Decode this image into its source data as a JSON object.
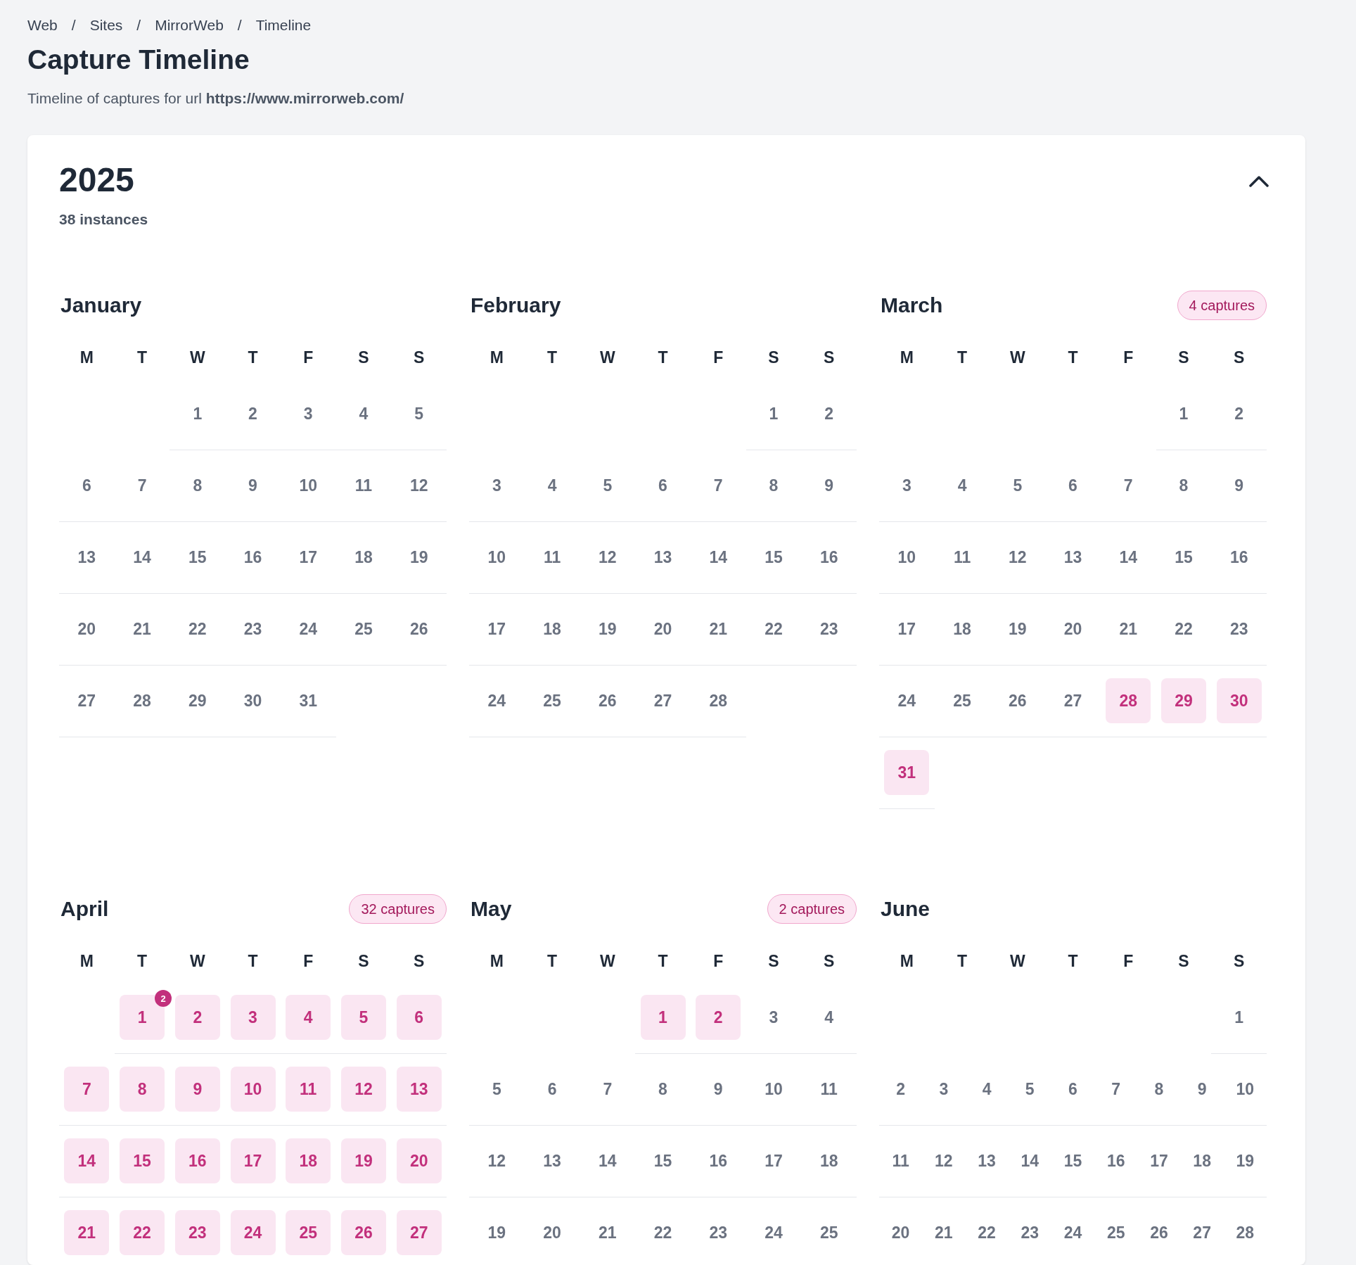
{
  "breadcrumb": {
    "items": [
      "Web",
      "Sites",
      "MirrorWeb",
      "Timeline"
    ],
    "separators": [
      "/",
      "/",
      "/"
    ]
  },
  "title": "Capture Timeline",
  "subtitle": "Timeline of captures for url **https://www.mirrorweb.com/**",
  "year": {
    "label": "2025",
    "instances": "38 instances",
    "expanded": true
  },
  "months": [
    {
      "name": "January",
      "weekdays": [
        "M",
        "T",
        "W",
        "T",
        "F",
        "S",
        "S"
      ],
      "weeks": [
        {
          "kind": "first",
          "days": [
            {
              "day": "1",
              "captured": false
            },
            {
              "day": "2",
              "captured": false
            },
            {
              "day": "3",
              "captured": false
            },
            {
              "day": "4",
              "captured": false
            },
            {
              "day": "5",
              "captured": false
            }
          ]
        },
        {
          "kind": "week",
          "days": [
            {
              "day": "6",
              "captured": false
            },
            {
              "day": "7",
              "captured": false
            },
            {
              "day": "8",
              "captured": false
            },
            {
              "day": "9",
              "captured": false
            },
            {
              "day": "10",
              "captured": false
            },
            {
              "day": "11",
              "captured": false
            },
            {
              "day": "12",
              "captured": false
            }
          ]
        },
        {
          "kind": "week",
          "days": [
            {
              "day": "13",
              "captured": false
            },
            {
              "day": "14",
              "captured": false
            },
            {
              "day": "15",
              "captured": false
            },
            {
              "day": "16",
              "captured": false
            },
            {
              "day": "17",
              "captured": false
            },
            {
              "day": "18",
              "captured": false
            },
            {
              "day": "19",
              "captured": false
            }
          ]
        },
        {
          "kind": "week",
          "days": [
            {
              "day": "20",
              "captured": false
            },
            {
              "day": "21",
              "captured": false
            },
            {
              "day": "22",
              "captured": false
            },
            {
              "day": "23",
              "captured": false
            },
            {
              "day": "24",
              "captured": false
            },
            {
              "day": "25",
              "captured": false
            },
            {
              "day": "26",
              "captured": false
            }
          ]
        },
        {
          "kind": "week",
          "days": [
            {
              "day": "27",
              "captured": false
            },
            {
              "day": "28",
              "captured": false
            },
            {
              "day": "29",
              "captured": false
            },
            {
              "day": "30",
              "captured": false
            },
            {
              "day": "31",
              "captured": false
            }
          ]
        }
      ]
    },
    {
      "name": "February",
      "weekdays": [
        "M",
        "T",
        "W",
        "T",
        "F",
        "S",
        "S"
      ],
      "weeks": [
        {
          "kind": "first",
          "days": [
            {
              "day": "1",
              "captured": false
            },
            {
              "day": "2",
              "captured": false
            }
          ]
        },
        {
          "kind": "week",
          "days": [
            {
              "day": "3",
              "captured": false
            },
            {
              "day": "4",
              "captured": false
            },
            {
              "day": "5",
              "captured": false
            },
            {
              "day": "6",
              "captured": false
            },
            {
              "day": "7",
              "captured": false
            },
            {
              "day": "8",
              "captured": false
            },
            {
              "day": "9",
              "captured": false
            }
          ]
        },
        {
          "kind": "week",
          "days": [
            {
              "day": "10",
              "captured": false
            },
            {
              "day": "11",
              "captured": false
            },
            {
              "day": "12",
              "captured": false
            },
            {
              "day": "13",
              "captured": false
            },
            {
              "day": "14",
              "captured": false
            },
            {
              "day": "15",
              "captured": false
            },
            {
              "day": "16",
              "captured": false
            }
          ]
        },
        {
          "kind": "week",
          "days": [
            {
              "day": "17",
              "captured": false
            },
            {
              "day": "18",
              "captured": false
            },
            {
              "day": "19",
              "captured": false
            },
            {
              "day": "20",
              "captured": false
            },
            {
              "day": "21",
              "captured": false
            },
            {
              "day": "22",
              "captured": false
            },
            {
              "day": "23",
              "captured": false
            }
          ]
        },
        {
          "kind": "week",
          "days": [
            {
              "day": "24",
              "captured": false
            },
            {
              "day": "25",
              "captured": false
            },
            {
              "day": "26",
              "captured": false
            },
            {
              "day": "27",
              "captured": false
            },
            {
              "day": "28",
              "captured": false
            }
          ]
        }
      ]
    },
    {
      "name": "March",
      "captures": "4 captures",
      "weekdays": [
        "M",
        "T",
        "W",
        "T",
        "F",
        "S",
        "S"
      ],
      "weeks": [
        {
          "kind": "first",
          "days": [
            {
              "day": "1",
              "captured": false
            },
            {
              "day": "2",
              "captured": false
            }
          ]
        },
        {
          "kind": "week",
          "days": [
            {
              "day": "3",
              "captured": false
            },
            {
              "day": "4",
              "captured": false
            },
            {
              "day": "5",
              "captured": false
            },
            {
              "day": "6",
              "captured": false
            },
            {
              "day": "7",
              "captured": false
            },
            {
              "day": "8",
              "captured": false
            },
            {
              "day": "9",
              "captured": false
            }
          ]
        },
        {
          "kind": "week",
          "days": [
            {
              "day": "10",
              "captured": false
            },
            {
              "day": "11",
              "captured": false
            },
            {
              "day": "12",
              "captured": false
            },
            {
              "day": "13",
              "captured": false
            },
            {
              "day": "14",
              "captured": false
            },
            {
              "day": "15",
              "captured": false
            },
            {
              "day": "16",
              "captured": false
            }
          ]
        },
        {
          "kind": "week",
          "days": [
            {
              "day": "17",
              "captured": false
            },
            {
              "day": "18",
              "captured": false
            },
            {
              "day": "19",
              "captured": false
            },
            {
              "day": "20",
              "captured": false
            },
            {
              "day": "21",
              "captured": false
            },
            {
              "day": "22",
              "captured": false
            },
            {
              "day": "23",
              "captured": false
            }
          ]
        },
        {
          "kind": "week",
          "days": [
            {
              "day": "24",
              "captured": false
            },
            {
              "day": "25",
              "captured": false
            },
            {
              "day": "26",
              "captured": false
            },
            {
              "day": "27",
              "captured": false
            },
            {
              "day": "28",
              "captured": true
            },
            {
              "day": "29",
              "captured": true
            },
            {
              "day": "30",
              "captured": true
            }
          ]
        },
        {
          "kind": "week",
          "days": [
            {
              "day": "31",
              "captured": true
            }
          ]
        }
      ]
    },
    {
      "name": "April",
      "captures": "32 captures",
      "weekdays": [
        "M",
        "T",
        "W",
        "T",
        "F",
        "S",
        "S"
      ],
      "weeks": [
        {
          "kind": "first",
          "days": [
            {
              "day": "1",
              "captured": true,
              "count": "2"
            },
            {
              "day": "2",
              "captured": true
            },
            {
              "day": "3",
              "captured": true
            },
            {
              "day": "4",
              "captured": true
            },
            {
              "day": "5",
              "captured": true
            },
            {
              "day": "6",
              "captured": true
            }
          ]
        },
        {
          "kind": "week",
          "days": [
            {
              "day": "7",
              "captured": true
            },
            {
              "day": "8",
              "captured": true
            },
            {
              "day": "9",
              "captured": true
            },
            {
              "day": "10",
              "captured": true
            },
            {
              "day": "11",
              "captured": true
            },
            {
              "day": "12",
              "captured": true
            },
            {
              "day": "13",
              "captured": true
            }
          ]
        },
        {
          "kind": "week",
          "days": [
            {
              "day": "14",
              "captured": true
            },
            {
              "day": "15",
              "captured": true
            },
            {
              "day": "16",
              "captured": true
            },
            {
              "day": "17",
              "captured": true
            },
            {
              "day": "18",
              "captured": true
            },
            {
              "day": "19",
              "captured": true
            },
            {
              "day": "20",
              "captured": true
            }
          ]
        },
        {
          "kind": "week",
          "days": [
            {
              "day": "21",
              "captured": true
            },
            {
              "day": "22",
              "captured": true
            },
            {
              "day": "23",
              "captured": true
            },
            {
              "day": "24",
              "captured": true
            },
            {
              "day": "25",
              "captured": true
            },
            {
              "day": "26",
              "captured": true
            },
            {
              "day": "27",
              "captured": true
            }
          ]
        }
      ]
    },
    {
      "name": "May",
      "captures": "2 captures",
      "weekdays": [
        "M",
        "T",
        "W",
        "T",
        "F",
        "S",
        "S"
      ],
      "weeks": [
        {
          "kind": "first",
          "days": [
            {
              "day": "1",
              "captured": true
            },
            {
              "day": "2",
              "captured": true
            },
            {
              "day": "3",
              "captured": false
            },
            {
              "day": "4",
              "captured": false
            }
          ]
        },
        {
          "kind": "week",
          "days": [
            {
              "day": "5",
              "captured": false
            },
            {
              "day": "6",
              "captured": false
            },
            {
              "day": "7",
              "captured": false
            },
            {
              "day": "8",
              "captured": false
            },
            {
              "day": "9",
              "captured": false
            },
            {
              "day": "10",
              "captured": false
            },
            {
              "day": "11",
              "captured": false
            }
          ]
        },
        {
          "kind": "week",
          "days": [
            {
              "day": "12",
              "captured": false
            },
            {
              "day": "13",
              "captured": false
            },
            {
              "day": "14",
              "captured": false
            },
            {
              "day": "15",
              "captured": false
            },
            {
              "day": "16",
              "captured": false
            },
            {
              "day": "17",
              "captured": false
            },
            {
              "day": "18",
              "captured": false
            }
          ]
        },
        {
          "kind": "week",
          "days": [
            {
              "day": "19",
              "captured": false
            },
            {
              "day": "20",
              "captured": false
            },
            {
              "day": "21",
              "captured": false
            },
            {
              "day": "22",
              "captured": false
            },
            {
              "day": "23",
              "captured": false
            },
            {
              "day": "24",
              "captured": false
            },
            {
              "day": "25",
              "captured": false
            }
          ]
        }
      ]
    },
    {
      "name": "June",
      "weekdays": [
        "M",
        "T",
        "W",
        "T",
        "F",
        "S",
        "S"
      ],
      "weeks": [
        {
          "kind": "first",
          "days": [
            {
              "day": "1",
              "captured": false
            }
          ]
        },
        {
          "kind": "week",
          "days": [
            {
              "day": "2",
              "captured": false
            },
            {
              "day": "3",
              "captured": false
            },
            {
              "day": "4",
              "captured": false
            },
            {
              "day": "5",
              "captured": false
            },
            {
              "day": "6",
              "captured": false
            },
            {
              "day": "7",
              "captured": false
            },
            {
              "day": "8",
              "captured": false
            },
            {
              "day": "9",
              "captured": false
            },
            {
              "day": "10",
              "captured": false
            }
          ]
        },
        {
          "kind": "week",
          "days": [
            {
              "day": "11",
              "captured": false
            },
            {
              "day": "12",
              "captured": false
            },
            {
              "day": "13",
              "captured": false
            },
            {
              "day": "14",
              "captured": false
            },
            {
              "day": "15",
              "captured": false
            },
            {
              "day": "16",
              "captured": false
            },
            {
              "day": "17",
              "captured": false
            },
            {
              "day": "18",
              "captured": false
            },
            {
              "day": "19",
              "captured": false
            }
          ]
        },
        {
          "kind": "week",
          "days": [
            {
              "day": "20",
              "captured": false
            },
            {
              "day": "21",
              "captured": false
            },
            {
              "day": "22",
              "captured": false
            },
            {
              "day": "23",
              "captured": false
            },
            {
              "day": "24",
              "captured": false
            },
            {
              "day": "25",
              "captured": false
            },
            {
              "day": "26",
              "captured": false
            },
            {
              "day": "27",
              "captured": false
            },
            {
              "day": "28",
              "captured": false
            }
          ]
        }
      ]
    }
  ]
}
